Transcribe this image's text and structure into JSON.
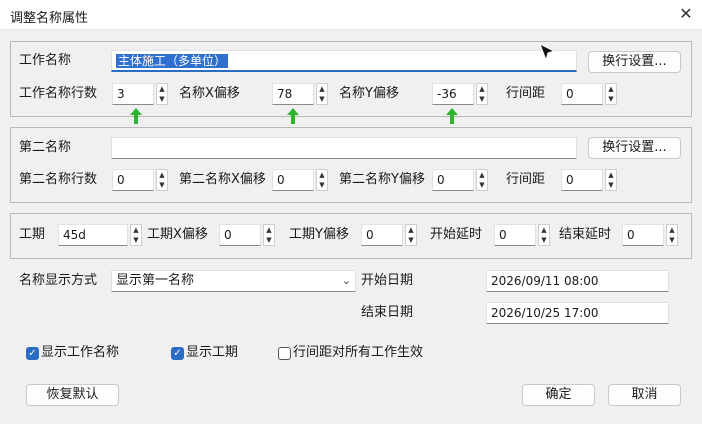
{
  "window": {
    "title": "调整名称属性"
  },
  "group1": {
    "work_name_label": "工作名称",
    "work_name_value": "主体施工（多单位）",
    "wrap_button": "换行设置...",
    "rows_label": "工作名称行数",
    "rows_value": "3",
    "x_offset_label": "名称X偏移",
    "x_offset_value": "78",
    "y_offset_label": "名称Y偏移",
    "y_offset_value": "-36",
    "line_spacing_label": "行间距",
    "line_spacing_value": "0"
  },
  "group2": {
    "second_name_label": "第二名称",
    "second_name_value": "",
    "wrap_button": "换行设置...",
    "rows_label": "第二名称行数",
    "rows_value": "0",
    "x_offset_label": "第二名称X偏移",
    "x_offset_value": "0",
    "y_offset_label": "第二名称Y偏移",
    "y_offset_value": "0",
    "line_spacing_label": "行间距",
    "line_spacing_value": "0"
  },
  "group3": {
    "duration_label": "工期",
    "duration_value": "45d",
    "dx_label": "工期X偏移",
    "dx_value": "0",
    "dy_label": "工期Y偏移",
    "dy_value": "0",
    "start_delay_label": "开始延时",
    "start_delay_value": "0",
    "end_delay_label": "结束延时",
    "end_delay_value": "0"
  },
  "display": {
    "mode_label": "名称显示方式",
    "mode_value": "显示第一名称",
    "start_date_label": "开始日期",
    "start_date_value": "2026/09/11 08:00",
    "end_date_label": "结束日期",
    "end_date_value": "2026/10/25 17:00"
  },
  "checks": {
    "show_name": "显示工作名称",
    "show_duration": "显示工期",
    "apply_spacing": "行间距对所有工作生效"
  },
  "buttons": {
    "restore": "恢复默认",
    "ok": "确定",
    "cancel": "取消"
  },
  "colors": {
    "accent": "#2b6cc4",
    "green_arrow": "#2db52d"
  }
}
